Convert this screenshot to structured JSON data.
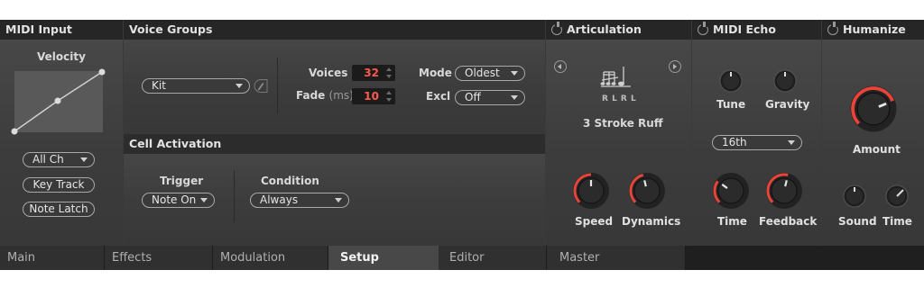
{
  "midi_input": {
    "title": "MIDI Input",
    "velocity_label": "Velocity",
    "channel_value": "All Ch",
    "key_track_label": "Key Track",
    "note_latch_label": "Note Latch"
  },
  "voice_groups": {
    "title": "Voice Groups",
    "group_value": "Kit",
    "voices_label": "Voices",
    "voices_value": "32",
    "fade_label": "Fade",
    "fade_unit": "(ms)",
    "fade_value": "10",
    "mode_label": "Mode",
    "mode_value": "Oldest",
    "excl_label": "Excl",
    "excl_value": "Off"
  },
  "cell_activation": {
    "title": "Cell Activation",
    "trigger_label": "Trigger",
    "trigger_value": "Note On",
    "condition_label": "Condition",
    "condition_value": "Always"
  },
  "articulation": {
    "title": "Articulation",
    "sticking": "R L R L",
    "name": "3 Stroke Ruff",
    "speed_label": "Speed",
    "dynamics_label": "Dynamics",
    "speed_level": 0.5,
    "dynamics_level": 0.45
  },
  "midi_echo": {
    "title": "MIDI Echo",
    "tune_label": "Tune",
    "gravity_label": "Gravity",
    "division_value": "16th",
    "time_label": "Time",
    "feedback_label": "Feedback",
    "time_level": 0.3,
    "feedback_level": 0.55
  },
  "humanize": {
    "title": "Humanize",
    "amount_label": "Amount",
    "sound_label": "Sound",
    "time_label": "Time",
    "amount_level": 0.75
  },
  "tabs": [
    "Main",
    "Effects",
    "Modulation",
    "Setup",
    "Editor",
    "Master"
  ],
  "active_tab": "Setup",
  "colors": {
    "accent": "#e8443a",
    "value_text": "#ff5a4e",
    "header_bg": "#262626"
  }
}
